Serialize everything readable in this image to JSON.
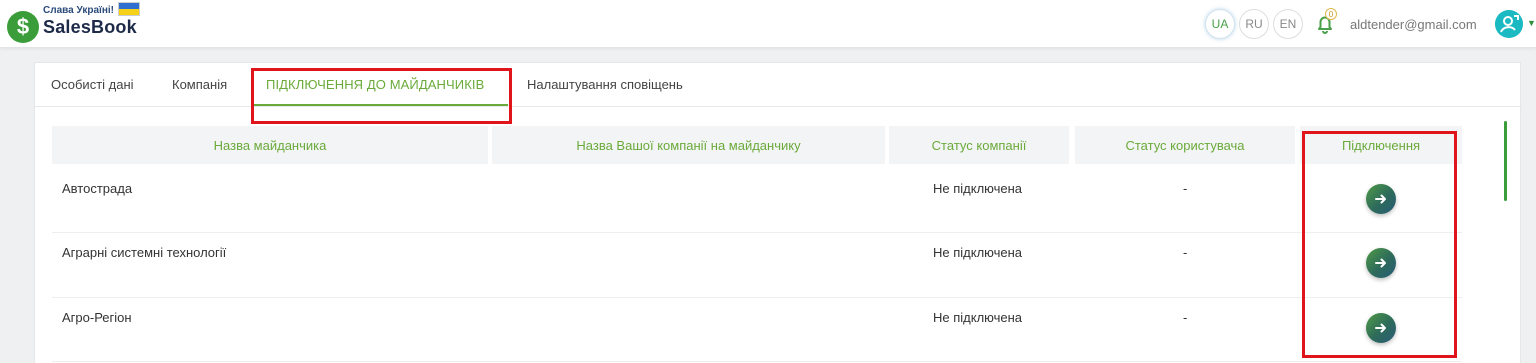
{
  "header": {
    "slava": "Слава Україні!",
    "brand": "SalesBook",
    "logo_symbol": "$",
    "languages": [
      {
        "code": "UA",
        "active": true
      },
      {
        "code": "RU",
        "active": false
      },
      {
        "code": "EN",
        "active": false
      }
    ],
    "notifications_count": "0",
    "user_email": "aldtender@gmail.com"
  },
  "tabs": [
    {
      "label": "Особисті дані",
      "active": false
    },
    {
      "label": "Компанія",
      "active": false
    },
    {
      "label": "ПІДКЛЮЧЕННЯ ДО МАЙДАНЧИКІВ",
      "active": true
    },
    {
      "label": "Налаштування сповіщень",
      "active": false
    }
  ],
  "table": {
    "columns": [
      "Назва майданчика",
      "Назва Вашої компанії на майданчику",
      "Статус компанії",
      "Статус користувача",
      "Підключення"
    ],
    "rows": [
      {
        "platform": "Автострада",
        "company_name": "",
        "company_status": "Не підключена",
        "user_status": "-"
      },
      {
        "platform": "Аграрні системні технології",
        "company_name": "",
        "company_status": "Не підключена",
        "user_status": "-"
      },
      {
        "platform": "Агро-Регіон",
        "company_name": "",
        "company_status": "Не підключена",
        "user_status": "-"
      }
    ]
  },
  "colors": {
    "accent_green": "#6aaa3a",
    "highlight_red": "#e0151b"
  },
  "icons": {
    "connect": "arrow-right-icon",
    "bell": "bell-icon",
    "avatar": "user-avatar-icon"
  }
}
